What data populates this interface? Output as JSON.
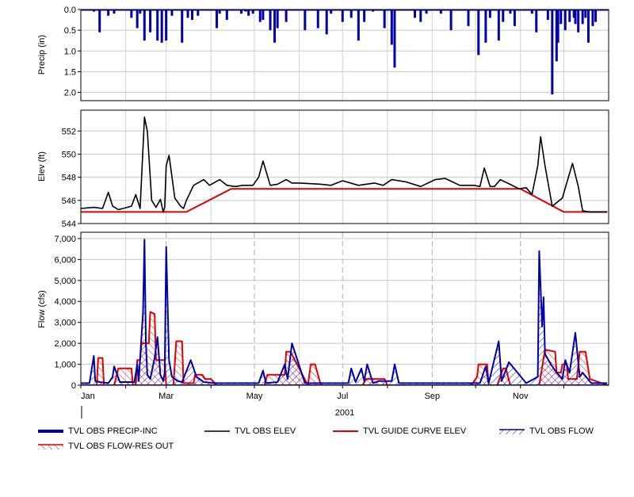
{
  "chart_data": [
    {
      "type": "bar",
      "panel": "precipitation",
      "ylabel": "Precip (in)",
      "ylim": [
        0.0,
        2.2
      ],
      "y_inverted": true,
      "yticks": [
        "0.0",
        "0.5",
        "1.0",
        "1.5",
        "2.0"
      ],
      "grid": true,
      "series": [
        {
          "name": "TVL OBS PRECIP-INC",
          "color": "#0000a8",
          "x": [
            "2001-01-10",
            "2001-01-14",
            "2001-01-20",
            "2001-01-24",
            "2001-02-05",
            "2001-02-09",
            "2001-02-11",
            "2001-02-14",
            "2001-02-18",
            "2001-02-23",
            "2001-02-26",
            "2001-03-01",
            "2001-03-05",
            "2001-03-12",
            "2001-03-16",
            "2001-03-19",
            "2001-03-23",
            "2001-04-05",
            "2001-04-07",
            "2001-04-12",
            "2001-04-22",
            "2001-04-25",
            "2001-04-27",
            "2001-04-30",
            "2001-05-05",
            "2001-05-07",
            "2001-05-12",
            "2001-05-15",
            "2001-05-17",
            "2001-05-23",
            "2001-06-05",
            "2001-06-14",
            "2001-06-20",
            "2001-06-23",
            "2001-07-01",
            "2001-07-07",
            "2001-07-12",
            "2001-07-16",
            "2001-07-22",
            "2001-07-30",
            "2001-08-04",
            "2001-08-06",
            "2001-08-20",
            "2001-08-24",
            "2001-08-28",
            "2001-09-07",
            "2001-09-14",
            "2001-09-26",
            "2001-10-03",
            "2001-10-08",
            "2001-10-11",
            "2001-10-17",
            "2001-10-20",
            "2001-10-25",
            "2001-10-28",
            "2001-11-09",
            "2001-11-12",
            "2001-11-20",
            "2001-11-23",
            "2001-11-26",
            "2001-11-27",
            "2001-11-29",
            "2001-12-02",
            "2001-12-05",
            "2001-12-08",
            "2001-12-09",
            "2001-12-11",
            "2001-12-14",
            "2001-12-16",
            "2001-12-18",
            "2001-12-21",
            "2001-12-23"
          ],
          "values": [
            0.05,
            0.55,
            0.15,
            0.1,
            0.2,
            0.45,
            0.1,
            0.75,
            0.55,
            0.75,
            0.8,
            0.75,
            0.15,
            0.8,
            0.2,
            0.25,
            0.15,
            0.45,
            0.1,
            0.25,
            0.1,
            0.05,
            0.15,
            0.1,
            0.3,
            0.25,
            0.5,
            0.8,
            0.45,
            0.3,
            0.5,
            0.45,
            0.6,
            0.1,
            0.3,
            0.2,
            0.75,
            0.3,
            0.05,
            0.45,
            0.85,
            1.4,
            0.2,
            0.3,
            0.1,
            0.1,
            0.5,
            0.4,
            1.1,
            0.8,
            0.2,
            0.75,
            0.3,
            0.1,
            0.4,
            0.1,
            0.55,
            0.25,
            2.05,
            1.25,
            0.8,
            0.35,
            0.5,
            0.3,
            0.2,
            0.35,
            0.55,
            0.35,
            0.2,
            0.8,
            0.4,
            0.3
          ]
        }
      ]
    },
    {
      "type": "line",
      "panel": "elevation",
      "ylabel": "Elev (ft)",
      "ylim": [
        544,
        553.8
      ],
      "yticks": [
        "544",
        "546",
        "548",
        "550",
        "552"
      ],
      "grid": true,
      "series": [
        {
          "name": "TVL OBS ELEV",
          "color": "#000000",
          "x": [
            "2001-01-01",
            "2001-01-10",
            "2001-01-16",
            "2001-01-20",
            "2001-01-23",
            "2001-01-27",
            "2001-02-05",
            "2001-02-08",
            "2001-02-11",
            "2001-02-14",
            "2001-02-16",
            "2001-02-19",
            "2001-02-22",
            "2001-02-25",
            "2001-02-27",
            "2001-02-28",
            "2001-03-01",
            "2001-03-03",
            "2001-03-07",
            "2001-03-11",
            "2001-03-13",
            "2001-03-15",
            "2001-03-20",
            "2001-03-27",
            "2001-03-31",
            "2001-04-07",
            "2001-04-12",
            "2001-04-18",
            "2001-04-23",
            "2001-04-30",
            "2001-05-04",
            "2001-05-07",
            "2001-05-12",
            "2001-05-17",
            "2001-05-23",
            "2001-05-27",
            "2001-06-01",
            "2001-06-16",
            "2001-06-23",
            "2001-07-01",
            "2001-07-12",
            "2001-07-23",
            "2001-07-29",
            "2001-08-04",
            "2001-08-14",
            "2001-08-24",
            "2001-09-03",
            "2001-09-10",
            "2001-09-20",
            "2001-09-30",
            "2001-10-04",
            "2001-10-07",
            "2001-10-11",
            "2001-10-14",
            "2001-10-18",
            "2001-10-23",
            "2001-10-31",
            "2001-11-05",
            "2001-11-09",
            "2001-11-13",
            "2001-11-15",
            "2001-11-18",
            "2001-11-23",
            "2001-11-26",
            "2001-11-30",
            "2001-12-03",
            "2001-12-07",
            "2001-12-11",
            "2001-12-14",
            "2001-12-19",
            "2001-12-25",
            "2001-12-31"
          ],
          "values": [
            545.3,
            545.4,
            545.3,
            546.7,
            545.5,
            545.2,
            545.5,
            546.5,
            545.3,
            553.2,
            552.0,
            546.0,
            545.4,
            546.1,
            545.0,
            545.4,
            549.0,
            549.9,
            546.2,
            545.5,
            545.3,
            546.0,
            547.3,
            547.8,
            547.3,
            547.8,
            547.3,
            547.2,
            547.3,
            547.3,
            548.0,
            549.4,
            547.3,
            547.4,
            547.8,
            547.5,
            547.5,
            547.4,
            547.3,
            547.7,
            547.3,
            547.5,
            547.3,
            547.8,
            547.6,
            547.2,
            547.8,
            547.9,
            547.3,
            547.3,
            547.2,
            548.8,
            547.2,
            547.2,
            547.8,
            547.5,
            547.0,
            547.1,
            546.5,
            549.0,
            551.5,
            549.0,
            545.5,
            545.8,
            546.2,
            547.5,
            549.2,
            547.2,
            545.1,
            545.0,
            545.0,
            545.0
          ]
        },
        {
          "name": "TVL GUIDE CURVE ELEV",
          "color": "#e00000",
          "x": [
            "2001-01-01",
            "2001-03-15",
            "2001-04-15",
            "2001-11-01",
            "2001-12-01",
            "2001-12-31"
          ],
          "values": [
            545.0,
            545.0,
            547.0,
            547.0,
            545.0,
            545.0
          ]
        }
      ]
    },
    {
      "type": "line",
      "panel": "flow",
      "ylabel": "Flow (cfs)",
      "ylim": [
        0,
        7300
      ],
      "yticks": [
        "0",
        "1,000",
        "2,000",
        "3,000",
        "4,000",
        "5,000",
        "6,000",
        "7,000"
      ],
      "xticks": [
        "Jan",
        "Mar",
        "May",
        "Jul",
        "Sep",
        "Nov"
      ],
      "xlabel": "2001",
      "grid": true,
      "series": [
        {
          "name": "TVL OBS FLOW",
          "color": "#0000a8",
          "x": [
            "2001-01-01",
            "2001-01-07",
            "2001-01-10",
            "2001-01-11",
            "2001-01-14",
            "2001-01-20",
            "2001-01-23",
            "2001-01-24",
            "2001-01-28",
            "2001-02-07",
            "2001-02-09",
            "2001-02-10",
            "2001-02-13",
            "2001-02-14",
            "2001-02-15",
            "2001-02-16",
            "2001-02-18",
            "2001-02-21",
            "2001-02-23",
            "2001-02-25",
            "2001-02-27",
            "2001-02-28",
            "2001-03-01",
            "2001-03-03",
            "2001-03-05",
            "2001-03-09",
            "2001-03-12",
            "2001-03-18",
            "2001-03-22",
            "2001-03-27",
            "2001-04-04",
            "2001-04-15",
            "2001-05-04",
            "2001-05-07",
            "2001-05-09",
            "2001-05-17",
            "2001-05-22",
            "2001-05-24",
            "2001-05-27",
            "2001-06-05",
            "2001-06-25",
            "2001-07-05",
            "2001-07-07",
            "2001-07-10",
            "2001-07-14",
            "2001-07-16",
            "2001-07-18",
            "2001-07-22",
            "2001-07-26",
            "2001-08-04",
            "2001-08-06",
            "2001-08-09",
            "2001-08-18",
            "2001-09-05",
            "2001-09-25",
            "2001-10-04",
            "2001-10-08",
            "2001-10-10",
            "2001-10-17",
            "2001-10-19",
            "2001-10-24",
            "2001-11-05",
            "2001-11-13",
            "2001-11-14",
            "2001-11-16",
            "2001-11-17",
            "2001-11-18",
            "2001-11-22",
            "2001-11-26",
            "2001-11-30",
            "2001-12-02",
            "2001-12-05",
            "2001-12-09",
            "2001-12-12",
            "2001-12-14",
            "2001-12-20",
            "2001-12-31"
          ],
          "values": [
            100,
            100,
            1400,
            200,
            150,
            100,
            400,
            900,
            150,
            150,
            1000,
            200,
            3500,
            6950,
            2000,
            500,
            300,
            1300,
            2300,
            500,
            200,
            600,
            6600,
            1200,
            400,
            200,
            150,
            1200,
            400,
            150,
            100,
            100,
            100,
            700,
            100,
            150,
            1000,
            300,
            2000,
            100,
            100,
            100,
            800,
            150,
            800,
            200,
            1000,
            100,
            200,
            200,
            1000,
            100,
            100,
            100,
            100,
            100,
            900,
            100,
            2100,
            200,
            1100,
            100,
            400,
            6400,
            2800,
            4200,
            1500,
            1000,
            600,
            300,
            1200,
            600,
            2500,
            400,
            600,
            100,
            100
          ]
        },
        {
          "name": "TVL OBS FLOW-RES OUT",
          "color": "#e00000",
          "x": [
            "2001-01-01",
            "2001-01-12",
            "2001-01-13",
            "2001-01-16",
            "2001-01-17",
            "2001-01-24",
            "2001-01-27",
            "2001-02-05",
            "2001-02-06",
            "2001-02-08",
            "2001-02-09",
            "2001-02-11",
            "2001-02-12",
            "2001-02-17",
            "2001-02-18",
            "2001-02-21",
            "2001-02-22",
            "2001-02-28",
            "2001-03-01",
            "2001-03-06",
            "2001-03-08",
            "2001-03-12",
            "2001-03-13",
            "2001-03-20",
            "2001-03-21",
            "2001-03-26",
            "2001-03-28",
            "2001-04-01",
            "2001-04-05",
            "2001-05-08",
            "2001-05-10",
            "2001-05-22",
            "2001-05-23",
            "2001-05-26",
            "2001-06-07",
            "2001-06-09",
            "2001-06-12",
            "2001-06-16",
            "2001-07-15",
            "2001-07-17",
            "2001-07-30",
            "2001-08-01",
            "2001-09-01",
            "2001-09-28",
            "2001-10-02",
            "2001-10-03",
            "2001-10-09",
            "2001-10-10",
            "2001-10-16",
            "2001-10-20",
            "2001-10-22",
            "2001-10-25",
            "2001-10-29",
            "2001-11-14",
            "2001-11-18",
            "2001-11-25",
            "2001-11-26",
            "2001-11-29",
            "2001-11-30",
            "2001-12-03",
            "2001-12-04",
            "2001-12-10",
            "2001-12-12",
            "2001-12-16",
            "2001-12-19",
            "2001-12-31"
          ],
          "values": [
            0,
            0,
            1300,
            1300,
            0,
            0,
            800,
            800,
            0,
            0,
            1200,
            1200,
            2000,
            2000,
            3500,
            3400,
            1200,
            1200,
            0,
            0,
            2100,
            2100,
            100,
            100,
            500,
            500,
            300,
            300,
            0,
            0,
            500,
            500,
            1600,
            1600,
            0,
            1000,
            1000,
            0,
            0,
            300,
            300,
            0,
            0,
            0,
            400,
            1000,
            1000,
            0,
            0,
            800,
            800,
            0,
            0,
            0,
            1700,
            1600,
            600,
            600,
            1000,
            1000,
            300,
            300,
            1600,
            1600,
            300,
            0
          ]
        }
      ]
    }
  ],
  "legend": [
    {
      "label": "TVL OBS PRECIP-INC",
      "style": "thick-blue-line"
    },
    {
      "label": "TVL OBS ELEV",
      "style": "black-line"
    },
    {
      "label": "TVL GUIDE CURVE ELEV",
      "style": "red-line"
    },
    {
      "label": "TVL OBS FLOW",
      "style": "blue-hatch"
    },
    {
      "label": "TVL OBS FLOW-RES OUT",
      "style": "red-hatch"
    }
  ]
}
